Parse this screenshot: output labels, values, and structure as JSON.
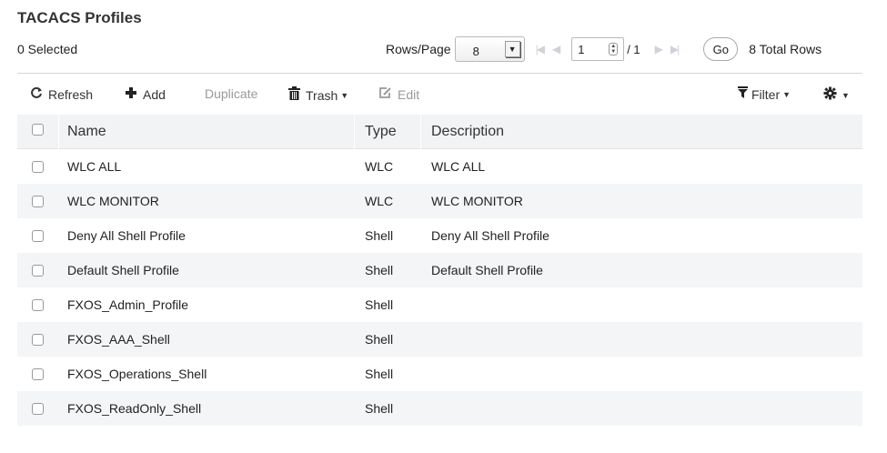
{
  "page": {
    "title": "TACACS Profiles",
    "selected_text": "0 Selected"
  },
  "pager": {
    "rows_label": "Rows/Page",
    "rows_value": "8",
    "current_page": "1",
    "of_text": "/ 1",
    "go_label": "Go",
    "total_text": "8 Total Rows"
  },
  "toolbar": {
    "refresh": "Refresh",
    "add": "Add",
    "duplicate": "Duplicate",
    "trash": "Trash",
    "edit": "Edit",
    "filter": "Filter"
  },
  "table": {
    "columns": {
      "name": "Name",
      "type": "Type",
      "description": "Description"
    },
    "rows": [
      {
        "name": "WLC ALL",
        "type": "WLC",
        "description": "WLC ALL"
      },
      {
        "name": "WLC MONITOR",
        "type": "WLC",
        "description": "WLC MONITOR"
      },
      {
        "name": "Deny All Shell Profile",
        "type": "Shell",
        "description": "Deny All Shell Profile"
      },
      {
        "name": "Default Shell Profile",
        "type": "Shell",
        "description": "Default Shell Profile"
      },
      {
        "name": "FXOS_Admin_Profile",
        "type": "Shell",
        "description": ""
      },
      {
        "name": "FXOS_AAA_Shell",
        "type": "Shell",
        "description": ""
      },
      {
        "name": "FXOS_Operations_Shell",
        "type": "Shell",
        "description": ""
      },
      {
        "name": "FXOS_ReadOnly_Shell",
        "type": "Shell",
        "description": ""
      }
    ]
  },
  "icons": {
    "refresh": "refresh-icon",
    "add": "plus-icon",
    "trash": "trash-icon",
    "edit": "edit-icon",
    "filter": "filter-icon",
    "settings": "gear-icon"
  }
}
